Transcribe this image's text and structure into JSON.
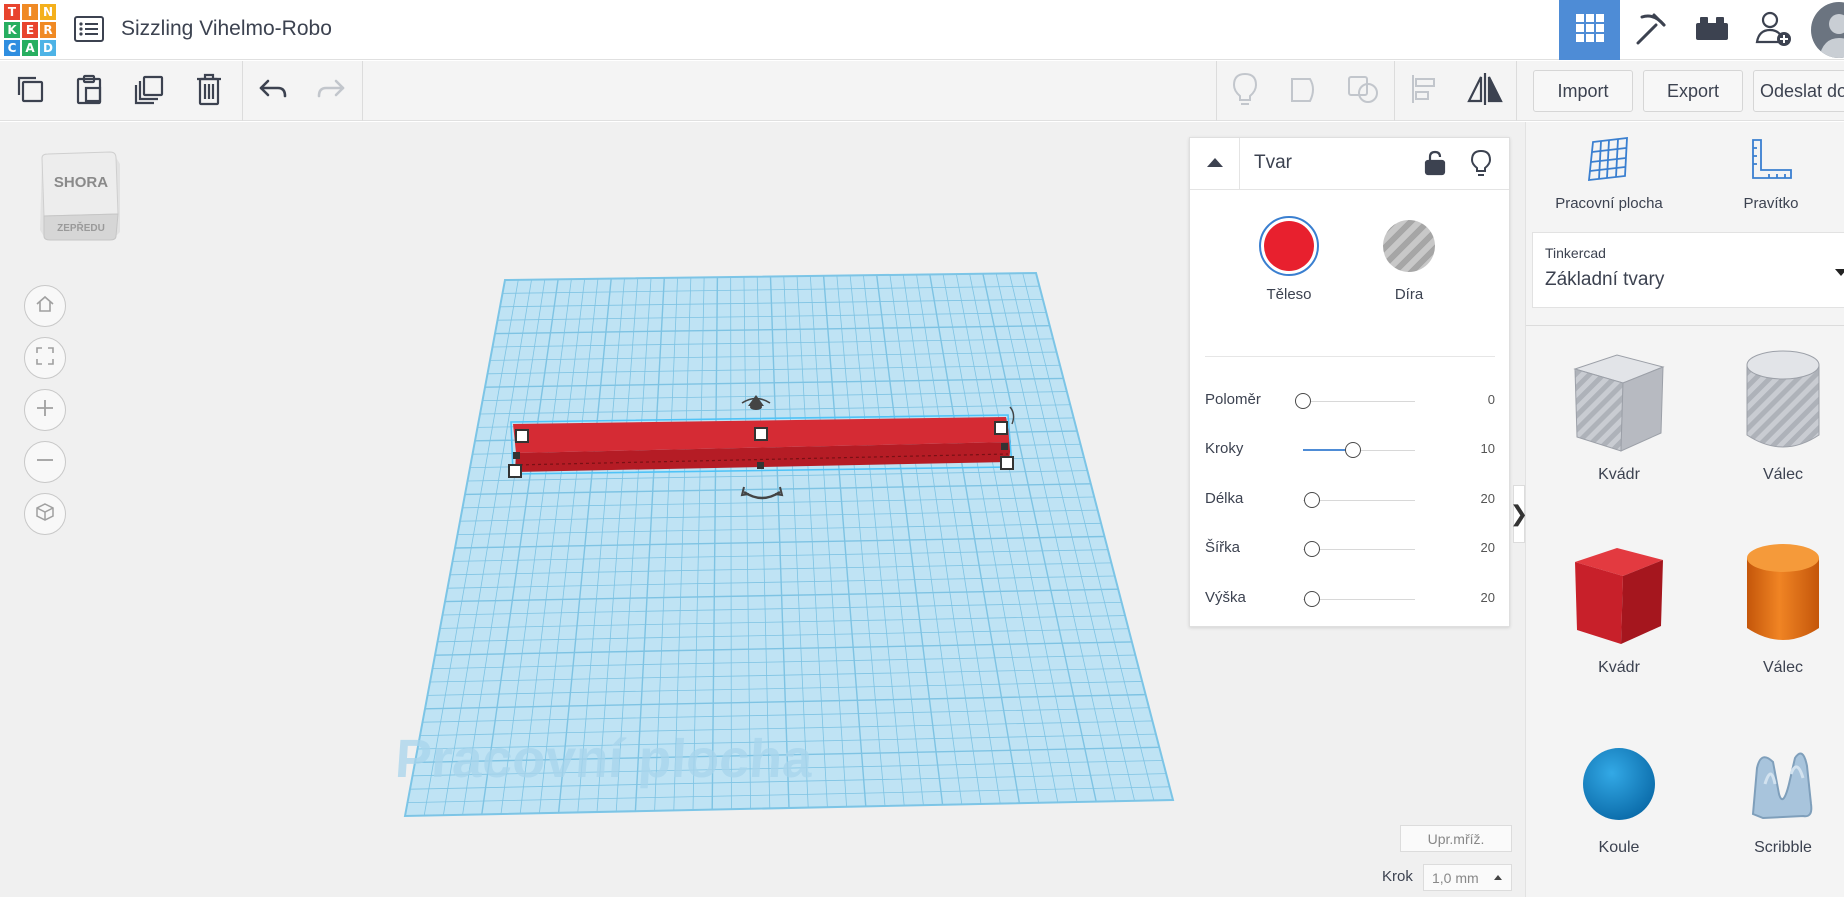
{
  "app": {
    "logo_letters": [
      "T",
      "I",
      "N",
      "K",
      "E",
      "R",
      "C",
      "A",
      "D"
    ],
    "logo_colors": [
      "#e8442e",
      "#f08a24",
      "#f4b01c",
      "#27ae60",
      "#e8442e",
      "#f08a24",
      "#2f8ee0",
      "#27ae60",
      "#4db3e6"
    ],
    "project_title": "Sizzling Vihelmo-Robo"
  },
  "topbar_right": [
    {
      "name": "3d-design-view",
      "icon": "grid-icon",
      "active": true
    },
    {
      "name": "codeblocks-view",
      "icon": "pickaxe-icon",
      "active": false
    },
    {
      "name": "bricks-view",
      "icon": "brick-icon",
      "active": false
    },
    {
      "name": "invite-user",
      "icon": "add-user-icon",
      "active": false
    }
  ],
  "toolbar": {
    "copy_icon": "copy-icon",
    "paste_icon": "paste-icon",
    "duplicate_icon": "duplicate-icon",
    "delete_icon": "trash-icon",
    "undo_icon": "undo-icon",
    "redo_icon": "redo-icon",
    "import_label": "Import",
    "export_label": "Export",
    "send_label": "Odeslat do"
  },
  "viewcube": {
    "top_label": "SHORA",
    "front_label": "ZEPŘEDU"
  },
  "workplane": {
    "label": "Pracovní plocha"
  },
  "shape_panel": {
    "title": "Tvar",
    "solid_label": "Těleso",
    "hole_label": "Díra",
    "solid_color": "#e8202e",
    "properties": [
      {
        "label": "Poloměr",
        "value": "0",
        "level": 0
      },
      {
        "label": "Kroky",
        "value": "10",
        "level": 0.45
      },
      {
        "label": "Délka",
        "value": "20",
        "level": 0.08
      },
      {
        "label": "Šířka",
        "value": "20",
        "level": 0.08
      },
      {
        "label": "Výška",
        "value": "20",
        "level": 0.08
      }
    ]
  },
  "grid_controls": {
    "edit_grid_label": "Upr.mříž.",
    "step_label": "Krok",
    "step_value": "1,0 mm"
  },
  "right_panel": {
    "workplane_tool": "Pracovní plocha",
    "ruler_tool": "Pravítko",
    "library_source": "Tinkercad",
    "library_name": "Základní tvary",
    "shapes": [
      {
        "label": "Kvádr",
        "icon": "striped-box-icon"
      },
      {
        "label": "Válec",
        "icon": "striped-cylinder-icon"
      },
      {
        "label": "Kvádr",
        "icon": "red-box-icon"
      },
      {
        "label": "Válec",
        "icon": "orange-cylinder-icon"
      },
      {
        "label": "Koule",
        "icon": "blue-sphere-icon"
      },
      {
        "label": "Scribble",
        "icon": "scribble-icon"
      }
    ]
  }
}
